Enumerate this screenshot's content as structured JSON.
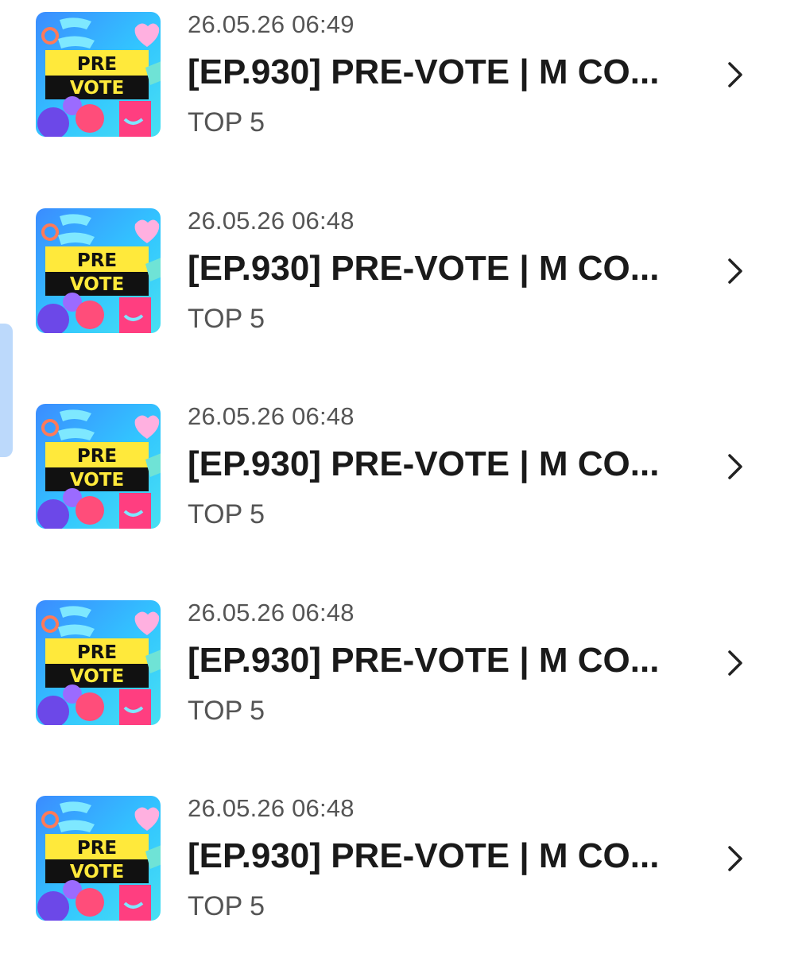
{
  "items": [
    {
      "date": "26.05.26 06:49",
      "title": "[EP.930] PRE-VOTE | M CO...",
      "subtitle": "TOP 5",
      "thumb_line1": "PRE",
      "thumb_line2": "VOTE"
    },
    {
      "date": "26.05.26 06:48",
      "title": "[EP.930] PRE-VOTE | M CO...",
      "subtitle": "TOP 5",
      "thumb_line1": "PRE",
      "thumb_line2": "VOTE"
    },
    {
      "date": "26.05.26 06:48",
      "title": "[EP.930] PRE-VOTE | M CO...",
      "subtitle": "TOP 5",
      "thumb_line1": "PRE",
      "thumb_line2": "VOTE"
    },
    {
      "date": "26.05.26 06:48",
      "title": "[EP.930] PRE-VOTE | M CO...",
      "subtitle": "TOP 5",
      "thumb_line1": "PRE",
      "thumb_line2": "VOTE"
    },
    {
      "date": "26.05.26 06:48",
      "title": "[EP.930] PRE-VOTE | M CO...",
      "subtitle": "TOP 5",
      "thumb_line1": "PRE",
      "thumb_line2": "VOTE"
    }
  ],
  "icons": {
    "row_action": "chevron-right-icon"
  },
  "colors": {
    "thumb_background": "#2ea8ff",
    "thumb_banner": "#ffe93b",
    "thumb_banner_dark": "#111111",
    "side_tab": "#bcd9fb"
  }
}
